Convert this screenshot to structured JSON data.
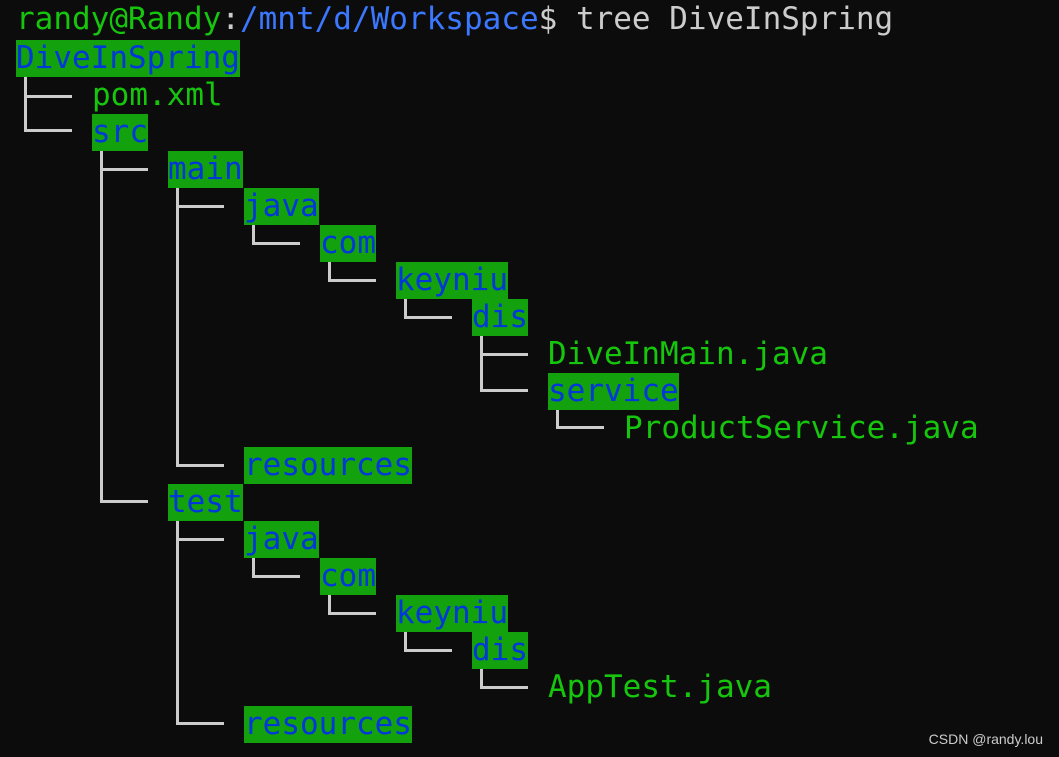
{
  "prompt": {
    "user_host": "randy@Randy",
    "separator": ":",
    "path": "/mnt/d/Workspace",
    "symbol": "$",
    "command": " tree DiveInSpring"
  },
  "tree": {
    "root": "DiveInSpring",
    "pom": "pom.xml",
    "src": "src",
    "main": "main",
    "main_java": "java",
    "main_com": "com",
    "main_keyniu": "keyniu",
    "main_dis": "dis",
    "main_file": "DiveInMain.java",
    "service": "service",
    "service_file": "ProductService.java",
    "main_resources": "resources",
    "test": "test",
    "test_java": "java",
    "test_com": "com",
    "test_keyniu": "keyniu",
    "test_dis": "dis",
    "test_file": "AppTest.java",
    "test_resources": "resources"
  },
  "watermark": "CSDN @randy.lou",
  "colors": {
    "background": "#0c0c0c",
    "dir_bg": "#13a10e",
    "dir_fg": "#0037da",
    "file_fg": "#16c60c",
    "path": "#3b78ff",
    "lines": "#cccccc"
  }
}
